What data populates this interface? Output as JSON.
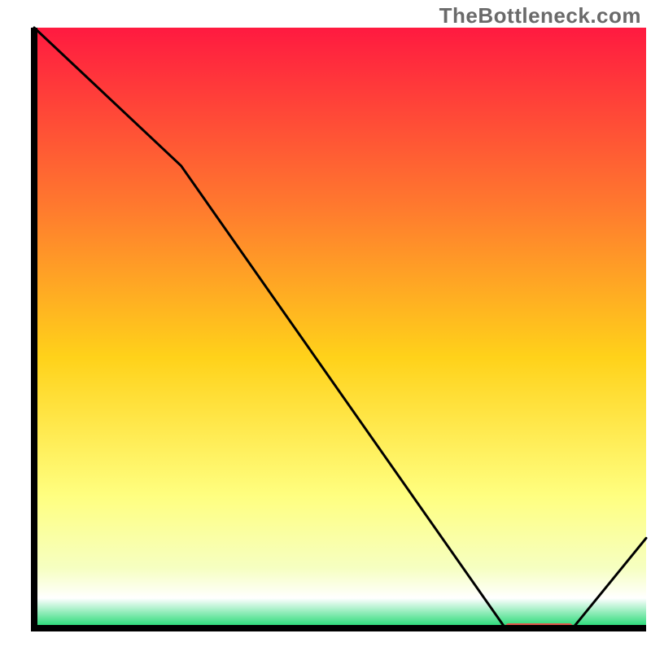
{
  "watermark": "TheBottleneck.com",
  "colors": {
    "grad_top": "#ff1a40",
    "grad_mid_upper": "#ff7a2e",
    "grad_mid": "#ffd21a",
    "grad_lower": "#ffff80",
    "grad_near_bottom": "#f6ffc1",
    "grad_white_band": "#ffffff",
    "grad_green": "#18d86d",
    "line": "#000000",
    "axis": "#000000",
    "marker": "#e2584c"
  },
  "chart_data": {
    "type": "line",
    "title": "",
    "xlabel": "",
    "ylabel": "",
    "xlim": [
      0,
      100
    ],
    "ylim": [
      0,
      100
    ],
    "x": [
      0,
      24,
      77,
      88,
      100
    ],
    "values": [
      100,
      77,
      0,
      0,
      15
    ],
    "marker_segment": {
      "x0": 77,
      "x1": 88,
      "y": 0
    },
    "notes": "Values are percentages of chart height estimated from pixel positions; no numeric axes are shown in the source image."
  }
}
